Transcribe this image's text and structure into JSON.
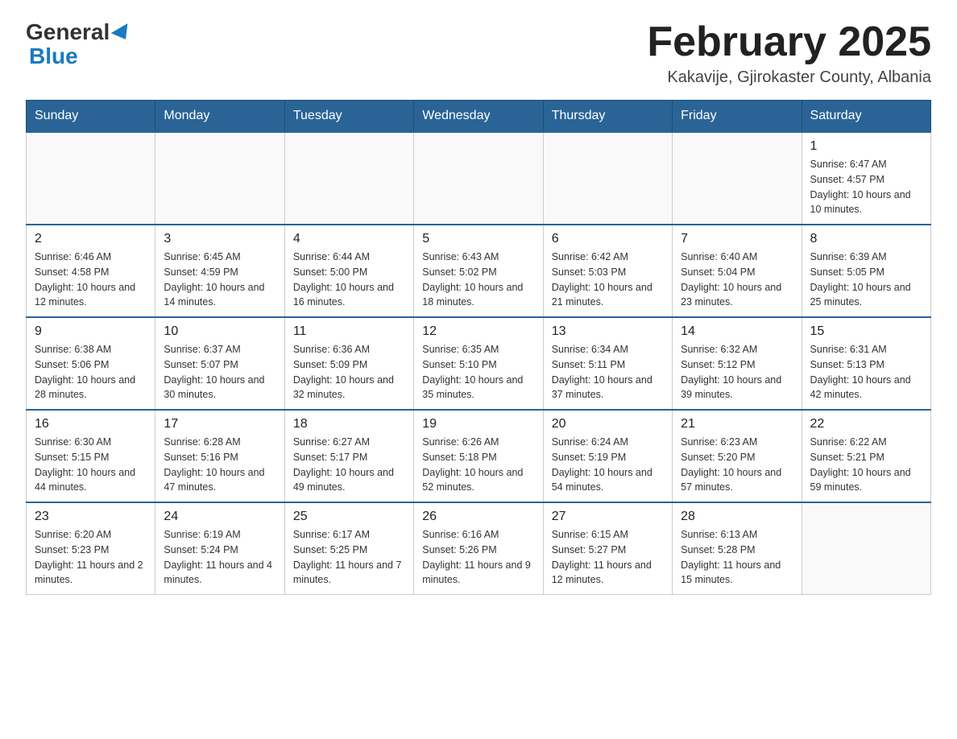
{
  "header": {
    "logo_general": "General",
    "logo_blue": "Blue",
    "month_title": "February 2025",
    "location": "Kakavije, Gjirokaster County, Albania"
  },
  "days_of_week": [
    "Sunday",
    "Monday",
    "Tuesday",
    "Wednesday",
    "Thursday",
    "Friday",
    "Saturday"
  ],
  "weeks": [
    [
      {
        "day": "",
        "sunrise": "",
        "sunset": "",
        "daylight": "",
        "empty": true
      },
      {
        "day": "",
        "sunrise": "",
        "sunset": "",
        "daylight": "",
        "empty": true
      },
      {
        "day": "",
        "sunrise": "",
        "sunset": "",
        "daylight": "",
        "empty": true
      },
      {
        "day": "",
        "sunrise": "",
        "sunset": "",
        "daylight": "",
        "empty": true
      },
      {
        "day": "",
        "sunrise": "",
        "sunset": "",
        "daylight": "",
        "empty": true
      },
      {
        "day": "",
        "sunrise": "",
        "sunset": "",
        "daylight": "",
        "empty": true
      },
      {
        "day": "1",
        "sunrise": "Sunrise: 6:47 AM",
        "sunset": "Sunset: 4:57 PM",
        "daylight": "Daylight: 10 hours and 10 minutes.",
        "empty": false
      }
    ],
    [
      {
        "day": "2",
        "sunrise": "Sunrise: 6:46 AM",
        "sunset": "Sunset: 4:58 PM",
        "daylight": "Daylight: 10 hours and 12 minutes.",
        "empty": false
      },
      {
        "day": "3",
        "sunrise": "Sunrise: 6:45 AM",
        "sunset": "Sunset: 4:59 PM",
        "daylight": "Daylight: 10 hours and 14 minutes.",
        "empty": false
      },
      {
        "day": "4",
        "sunrise": "Sunrise: 6:44 AM",
        "sunset": "Sunset: 5:00 PM",
        "daylight": "Daylight: 10 hours and 16 minutes.",
        "empty": false
      },
      {
        "day": "5",
        "sunrise": "Sunrise: 6:43 AM",
        "sunset": "Sunset: 5:02 PM",
        "daylight": "Daylight: 10 hours and 18 minutes.",
        "empty": false
      },
      {
        "day": "6",
        "sunrise": "Sunrise: 6:42 AM",
        "sunset": "Sunset: 5:03 PM",
        "daylight": "Daylight: 10 hours and 21 minutes.",
        "empty": false
      },
      {
        "day": "7",
        "sunrise": "Sunrise: 6:40 AM",
        "sunset": "Sunset: 5:04 PM",
        "daylight": "Daylight: 10 hours and 23 minutes.",
        "empty": false
      },
      {
        "day": "8",
        "sunrise": "Sunrise: 6:39 AM",
        "sunset": "Sunset: 5:05 PM",
        "daylight": "Daylight: 10 hours and 25 minutes.",
        "empty": false
      }
    ],
    [
      {
        "day": "9",
        "sunrise": "Sunrise: 6:38 AM",
        "sunset": "Sunset: 5:06 PM",
        "daylight": "Daylight: 10 hours and 28 minutes.",
        "empty": false
      },
      {
        "day": "10",
        "sunrise": "Sunrise: 6:37 AM",
        "sunset": "Sunset: 5:07 PM",
        "daylight": "Daylight: 10 hours and 30 minutes.",
        "empty": false
      },
      {
        "day": "11",
        "sunrise": "Sunrise: 6:36 AM",
        "sunset": "Sunset: 5:09 PM",
        "daylight": "Daylight: 10 hours and 32 minutes.",
        "empty": false
      },
      {
        "day": "12",
        "sunrise": "Sunrise: 6:35 AM",
        "sunset": "Sunset: 5:10 PM",
        "daylight": "Daylight: 10 hours and 35 minutes.",
        "empty": false
      },
      {
        "day": "13",
        "sunrise": "Sunrise: 6:34 AM",
        "sunset": "Sunset: 5:11 PM",
        "daylight": "Daylight: 10 hours and 37 minutes.",
        "empty": false
      },
      {
        "day": "14",
        "sunrise": "Sunrise: 6:32 AM",
        "sunset": "Sunset: 5:12 PM",
        "daylight": "Daylight: 10 hours and 39 minutes.",
        "empty": false
      },
      {
        "day": "15",
        "sunrise": "Sunrise: 6:31 AM",
        "sunset": "Sunset: 5:13 PM",
        "daylight": "Daylight: 10 hours and 42 minutes.",
        "empty": false
      }
    ],
    [
      {
        "day": "16",
        "sunrise": "Sunrise: 6:30 AM",
        "sunset": "Sunset: 5:15 PM",
        "daylight": "Daylight: 10 hours and 44 minutes.",
        "empty": false
      },
      {
        "day": "17",
        "sunrise": "Sunrise: 6:28 AM",
        "sunset": "Sunset: 5:16 PM",
        "daylight": "Daylight: 10 hours and 47 minutes.",
        "empty": false
      },
      {
        "day": "18",
        "sunrise": "Sunrise: 6:27 AM",
        "sunset": "Sunset: 5:17 PM",
        "daylight": "Daylight: 10 hours and 49 minutes.",
        "empty": false
      },
      {
        "day": "19",
        "sunrise": "Sunrise: 6:26 AM",
        "sunset": "Sunset: 5:18 PM",
        "daylight": "Daylight: 10 hours and 52 minutes.",
        "empty": false
      },
      {
        "day": "20",
        "sunrise": "Sunrise: 6:24 AM",
        "sunset": "Sunset: 5:19 PM",
        "daylight": "Daylight: 10 hours and 54 minutes.",
        "empty": false
      },
      {
        "day": "21",
        "sunrise": "Sunrise: 6:23 AM",
        "sunset": "Sunset: 5:20 PM",
        "daylight": "Daylight: 10 hours and 57 minutes.",
        "empty": false
      },
      {
        "day": "22",
        "sunrise": "Sunrise: 6:22 AM",
        "sunset": "Sunset: 5:21 PM",
        "daylight": "Daylight: 10 hours and 59 minutes.",
        "empty": false
      }
    ],
    [
      {
        "day": "23",
        "sunrise": "Sunrise: 6:20 AM",
        "sunset": "Sunset: 5:23 PM",
        "daylight": "Daylight: 11 hours and 2 minutes.",
        "empty": false
      },
      {
        "day": "24",
        "sunrise": "Sunrise: 6:19 AM",
        "sunset": "Sunset: 5:24 PM",
        "daylight": "Daylight: 11 hours and 4 minutes.",
        "empty": false
      },
      {
        "day": "25",
        "sunrise": "Sunrise: 6:17 AM",
        "sunset": "Sunset: 5:25 PM",
        "daylight": "Daylight: 11 hours and 7 minutes.",
        "empty": false
      },
      {
        "day": "26",
        "sunrise": "Sunrise: 6:16 AM",
        "sunset": "Sunset: 5:26 PM",
        "daylight": "Daylight: 11 hours and 9 minutes.",
        "empty": false
      },
      {
        "day": "27",
        "sunrise": "Sunrise: 6:15 AM",
        "sunset": "Sunset: 5:27 PM",
        "daylight": "Daylight: 11 hours and 12 minutes.",
        "empty": false
      },
      {
        "day": "28",
        "sunrise": "Sunrise: 6:13 AM",
        "sunset": "Sunset: 5:28 PM",
        "daylight": "Daylight: 11 hours and 15 minutes.",
        "empty": false
      },
      {
        "day": "",
        "sunrise": "",
        "sunset": "",
        "daylight": "",
        "empty": true
      }
    ]
  ]
}
